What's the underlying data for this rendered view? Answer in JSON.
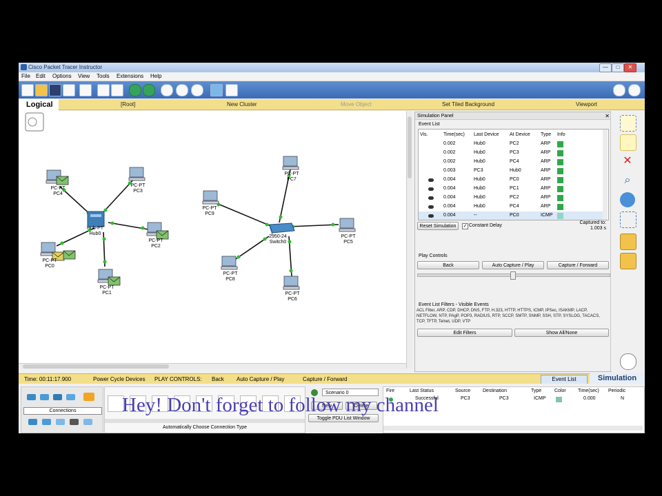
{
  "window": {
    "title": "Cisco Packet Tracer Instructor",
    "min": "—",
    "max": "□",
    "close": "✕"
  },
  "menu": [
    "File",
    "Edit",
    "Options",
    "View",
    "Tools",
    "Extensions",
    "Help"
  ],
  "nav": {
    "logical": "Logical",
    "root": "[Root]",
    "new_cluster": "New Cluster",
    "move_object": "Move Object",
    "set_bg": "Set Tiled Background",
    "viewport": "Viewport"
  },
  "topology": {
    "hub_model": "Hub-PT",
    "hub_name": "Hub0",
    "switch_model": "2950-24",
    "switch_name": "Switch0",
    "pc_model": "PC-PT",
    "pcs": [
      "PC4",
      "PC3",
      "PC2",
      "PC1",
      "PC0",
      "PC9",
      "PC7",
      "PC5",
      "PC6",
      "PC8"
    ]
  },
  "simulation": {
    "panel_title": "Simulation Panel",
    "event_list_label": "Event List",
    "columns": [
      "Vis.",
      "Time(sec)",
      "Last Device",
      "At Device",
      "Type",
      "Info"
    ],
    "events": [
      {
        "time": "0.002",
        "last": "Hub0",
        "at": "PC2",
        "type": "ARP"
      },
      {
        "time": "0.002",
        "last": "Hub0",
        "at": "PC3",
        "type": "ARP"
      },
      {
        "time": "0.002",
        "last": "Hub0",
        "at": "PC4",
        "type": "ARP"
      },
      {
        "time": "0.003",
        "last": "PC3",
        "at": "Hub0",
        "type": "ARP"
      },
      {
        "time": "0.004",
        "last": "Hub0",
        "at": "PC0",
        "type": "ARP"
      },
      {
        "time": "0.004",
        "last": "Hub0",
        "at": "PC1",
        "type": "ARP"
      },
      {
        "time": "0.004",
        "last": "Hub0",
        "at": "PC2",
        "type": "ARP"
      },
      {
        "time": "0.004",
        "last": "Hub0",
        "at": "PC4",
        "type": "ARP"
      },
      {
        "time": "0.004",
        "last": "--",
        "at": "PC0",
        "type": "ICMP"
      }
    ],
    "reset": "Reset Simulation",
    "constant_delay": "Constant Delay",
    "captured_label": "Captured to:",
    "captured_value": "1.003 s",
    "play_controls": "Play Controls",
    "back": "Back",
    "auto_capture": "Auto Capture / Play",
    "capture_forward": "Capture / Forward",
    "filters_title": "Event List Filters - Visible Events",
    "filters_text": "ACL Filter, ARP, CDP, DHCP, DNS, FTP, H.323, HTTP, HTTPS, ICMP, IPSec, ISAKMP, LACP, NETFLOW, NTP, PAgP, POP3, RADIUS, RTP, SCCP, SMTP, SNMP, SSH, STP, SYSLOG, TACACS, TCP, TFTP, Telnet, UDP, VTP",
    "edit_filters": "Edit Filters",
    "show_all": "Show All/None"
  },
  "status": {
    "time": "Time: 00:11:17.900",
    "power_cycle": "Power Cycle Devices",
    "play_controls": "PLAY CONTROLS:",
    "back": "Back",
    "auto_capture": "Auto Capture / Play",
    "capture_forward": "Capture / Forward",
    "event_list": "Event List",
    "simulation": "Simulation"
  },
  "bottom": {
    "connections_label": "Connections",
    "cable_hint": "Automatically Choose Connection Type",
    "scenario": "Scenario 0",
    "new": "New",
    "delete": "Delete",
    "toggle_pdu": "Toggle PDU List Window",
    "pdu_columns": [
      "Fire",
      "Last Status",
      "Source",
      "Destination",
      "Type",
      "Color",
      "Time(sec)",
      "Periodic"
    ],
    "pdu_row": {
      "status": "Successful",
      "source": "PC3",
      "destination": "PC3",
      "type": "ICMP",
      "time": "0.000",
      "periodic": "N"
    }
  },
  "watermark": "Hey! Don't forget to follow my channel",
  "colors": {
    "accent_blue": "#3b6cb3",
    "bar_yellow": "#f3df8a",
    "info_green": "#2fa84a",
    "link_green": "#2bc02b"
  }
}
